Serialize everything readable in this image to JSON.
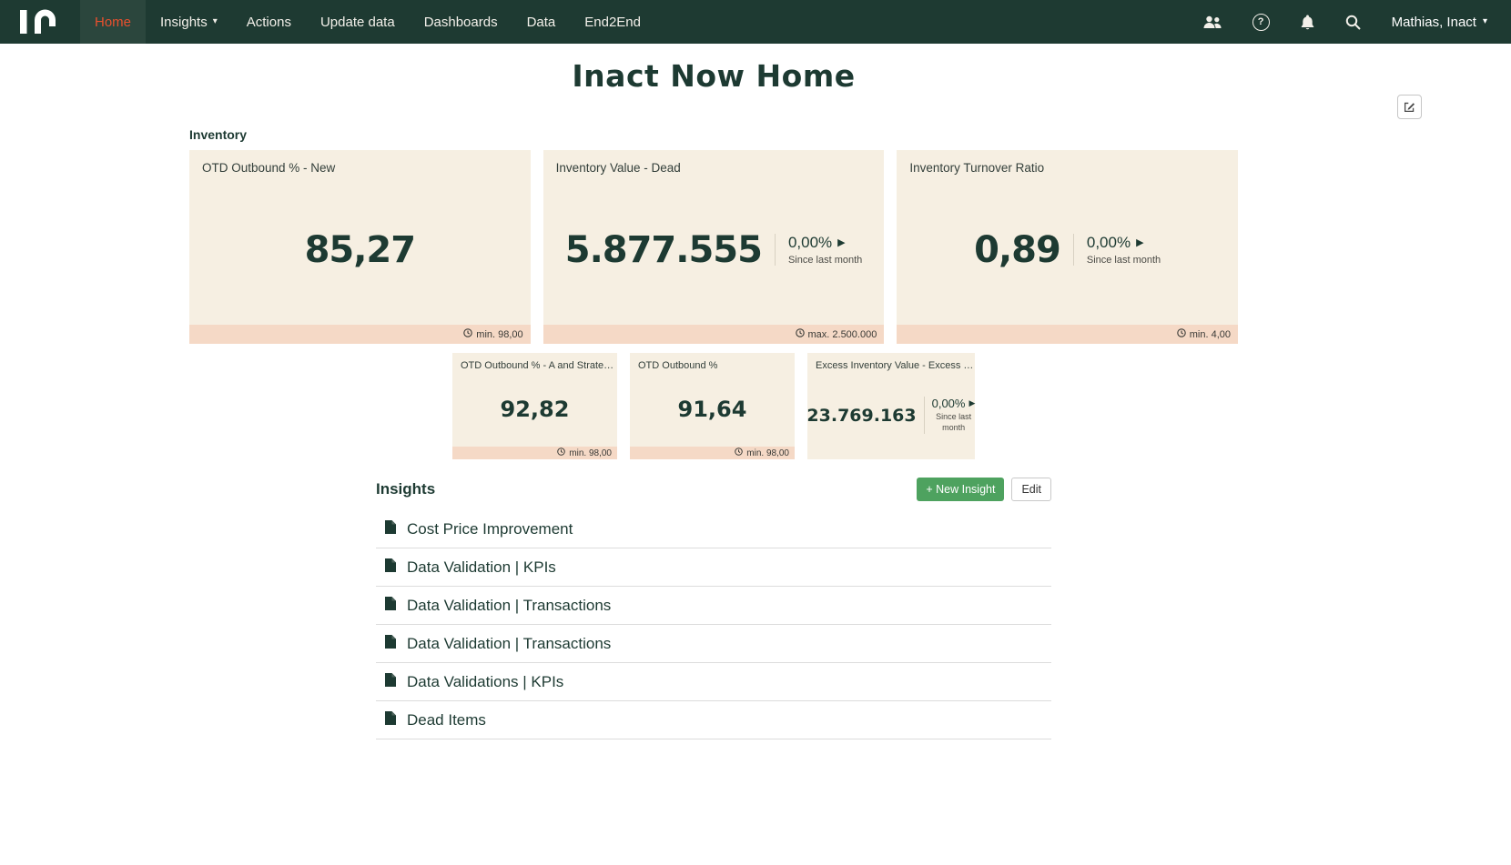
{
  "icons": {
    "caret_down": "▾",
    "play": "▶",
    "help": "?"
  },
  "colors": {
    "navbar_bg": "#1e3a32",
    "accent_orange": "#e8502e",
    "card_bg": "#f6efe2",
    "card_strip": "#f5d9c6",
    "text_dark_green": "#1d3a32",
    "button_green": "#4ea25f"
  },
  "navbar": {
    "nav_items": [
      {
        "label": "Home"
      },
      {
        "label": "Insights"
      },
      {
        "label": "Actions"
      },
      {
        "label": "Update data"
      },
      {
        "label": "Dashboards"
      },
      {
        "label": "Data"
      },
      {
        "label": "End2End"
      }
    ],
    "user_label": "Mathias, Inact"
  },
  "page": {
    "title": "Inact Now Home"
  },
  "inventory": {
    "section_label": "Inventory",
    "kpi_cards": [
      {
        "title": "OTD Outbound % - New",
        "value": "85,27",
        "threshold": "min. 98,00"
      },
      {
        "title": "Inventory Value - Dead",
        "value": "5.877.555",
        "delta": "0,00%",
        "delta_caption": "Since last month",
        "threshold": "max. 2.500.000"
      },
      {
        "title": "Inventory Turnover Ratio",
        "value": "0,89",
        "delta": "0,00%",
        "delta_caption": "Since last month",
        "threshold": "min. 4,00"
      }
    ],
    "small_cards": [
      {
        "title": "OTD Outbound % - A and Strate…",
        "value": "92,82",
        "threshold": "min. 98,00"
      },
      {
        "title": "OTD Outbound %",
        "value": "91,64",
        "threshold": "min. 98,00"
      },
      {
        "title": "Excess Inventory Value - Excess …",
        "value": "23.769.163",
        "delta": "0,00%",
        "delta_caption": "Since last month"
      }
    ]
  },
  "insights": {
    "section_label": "Insights",
    "new_insight_button": "+ New Insight",
    "edit_button": "Edit",
    "items": [
      "Cost Price Improvement",
      "Data Validation | KPIs",
      "Data Validation | Transactions",
      "Data Validation | Transactions",
      "Data Validations | KPIs",
      "Dead Items"
    ]
  }
}
